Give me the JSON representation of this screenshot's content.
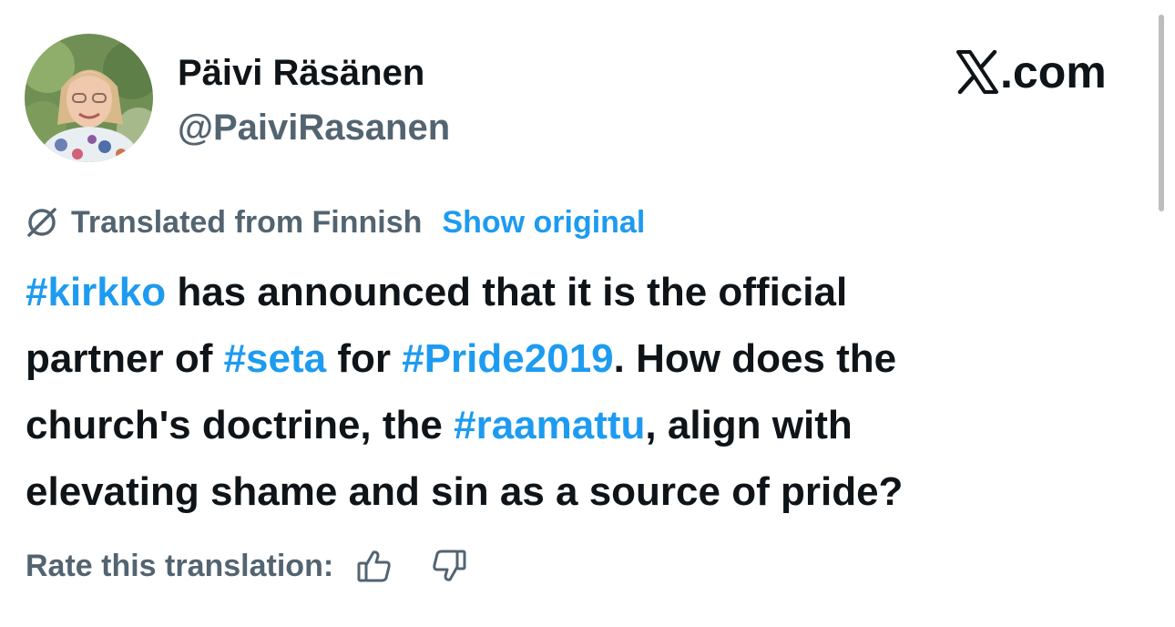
{
  "author": {
    "display_name": "Päivi Räsänen",
    "handle": "@PaiviRasanen",
    "avatar_icon": "profile-photo"
  },
  "brand": {
    "logo_icon": "x-logo-icon",
    "text": ".com"
  },
  "translation": {
    "icon": "translate-globe-icon",
    "label": "Translated from Finnish",
    "show_original": "Show original"
  },
  "tweet": {
    "lines": [
      [
        {
          "text": "#kirkko",
          "hashtag": true
        },
        {
          "text": " has announced that it is the official",
          "hashtag": false
        }
      ],
      [
        {
          "text": "partner of ",
          "hashtag": false
        },
        {
          "text": "#seta",
          "hashtag": true
        },
        {
          "text": " for ",
          "hashtag": false
        },
        {
          "text": "#Pride2019",
          "hashtag": true
        },
        {
          "text": ". How does the",
          "hashtag": false
        }
      ],
      [
        {
          "text": "church's doctrine, the ",
          "hashtag": false
        },
        {
          "text": "#raamattu",
          "hashtag": true
        },
        {
          "text": ", align with",
          "hashtag": false
        }
      ],
      [
        {
          "text": "elevating shame and sin as a source of pride?",
          "hashtag": false
        }
      ]
    ]
  },
  "rating": {
    "label": "Rate this translation:",
    "up_icon": "thumbs-up-icon",
    "down_icon": "thumbs-down-icon"
  },
  "colors": {
    "text": "#0f1419",
    "secondary": "#536471",
    "link": "#1d9bf0"
  }
}
